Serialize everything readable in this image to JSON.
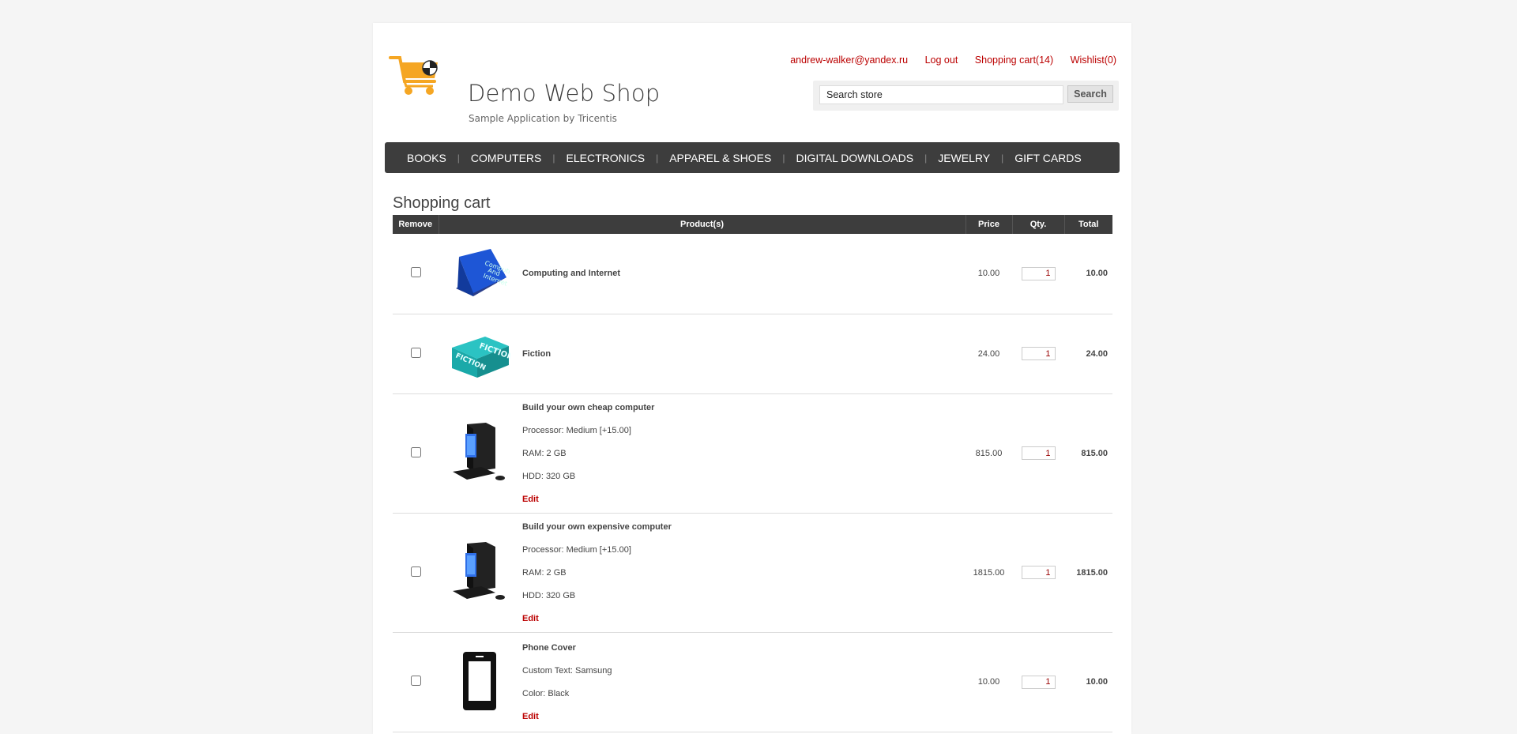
{
  "header": {
    "title": "Demo Web Shop",
    "subtitle": "Sample Application by Tricentis",
    "links": {
      "email": "andrew-walker@yandex.ru",
      "logout": "Log out",
      "cart": "Shopping cart(14)",
      "wishlist": "Wishlist(0)"
    },
    "search": {
      "value": "Search store",
      "button": "Search"
    }
  },
  "menu": [
    "BOOKS",
    "COMPUTERS",
    "ELECTRONICS",
    "APPAREL & SHOES",
    "DIGITAL DOWNLOADS",
    "JEWELRY",
    "GIFT CARDS"
  ],
  "page_title": "Shopping cart",
  "table": {
    "headers": {
      "remove": "Remove",
      "product": "Product(s)",
      "price": "Price",
      "qty": "Qty.",
      "total": "Total"
    },
    "rows": [
      {
        "name": "Computing and Internet",
        "attrs": [],
        "edit": "",
        "price": "10.00",
        "qty": "1",
        "total": "10.00",
        "image": "book-blue-icon"
      },
      {
        "name": "Fiction",
        "attrs": [],
        "edit": "",
        "price": "24.00",
        "qty": "1",
        "total": "24.00",
        "image": "book-teal-icon"
      },
      {
        "name": "Build your own cheap computer",
        "attrs": [
          "Processor: Medium [+15.00]",
          "RAM: 2 GB",
          "HDD: 320 GB"
        ],
        "edit": "Edit",
        "price": "815.00",
        "qty": "1",
        "total": "815.00",
        "image": "desktop-computer-icon"
      },
      {
        "name": "Build your own expensive computer",
        "attrs": [
          "Processor: Medium [+15.00]",
          "RAM: 2 GB",
          "HDD: 320 GB"
        ],
        "edit": "Edit",
        "price": "1815.00",
        "qty": "1",
        "total": "1815.00",
        "image": "desktop-computer-icon"
      },
      {
        "name": "Phone Cover",
        "attrs": [
          "Custom Text: Samsung",
          "Color: Black"
        ],
        "edit": "Edit",
        "price": "10.00",
        "qty": "1",
        "total": "10.00",
        "image": "phone-cover-icon"
      }
    ]
  },
  "colors": {
    "link": "#bb0000",
    "menu_bg": "#3d3d3d",
    "total": "#1a7a1a",
    "logo": "#f5a623"
  }
}
